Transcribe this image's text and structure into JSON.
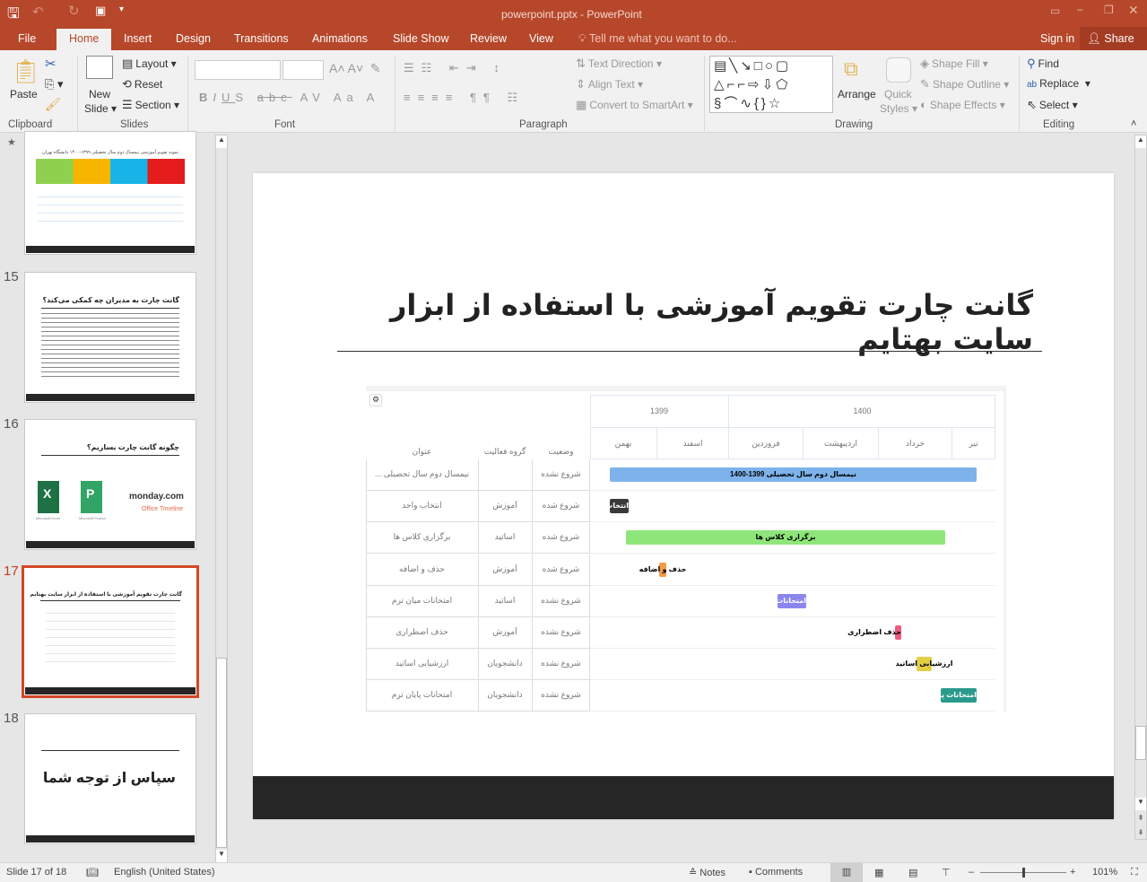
{
  "window": {
    "title": "powerpoint.pptx - PowerPoint"
  },
  "tabs": [
    "File",
    "Home",
    "Insert",
    "Design",
    "Transitions",
    "Animations",
    "Slide Show",
    "Review",
    "View"
  ],
  "tell_me": "Tell me what you want to do...",
  "sign_in": "Sign in",
  "share": "Share",
  "ribbon": {
    "clipboard": {
      "label": "Clipboard",
      "paste": "Paste"
    },
    "slides": {
      "label": "Slides",
      "new_slide": "New",
      "new_slide2": "Slide",
      "layout": "Layout",
      "reset": "Reset",
      "section": "Section"
    },
    "font": {
      "label": "Font"
    },
    "paragraph": {
      "label": "Paragraph",
      "text_direction": "Text Direction",
      "align_text": "Align Text",
      "convert_smartart": "Convert to SmartArt"
    },
    "drawing": {
      "label": "Drawing",
      "arrange": "Arrange",
      "quick": "Quick",
      "styles": "Styles",
      "shape_fill": "Shape Fill",
      "shape_outline": "Shape Outline",
      "shape_effects": "Shape Effects"
    },
    "editing": {
      "label": "Editing",
      "find": "Find",
      "replace": "Replace",
      "select": "Select"
    }
  },
  "thumbnails": [
    {
      "num": "",
      "title": "نمونه تقویم آموزشی نیمسال دوم سال تحصیلی ۱۳۹۹-۱۴۰۰ دانشگاه تهران"
    },
    {
      "num": "15",
      "title": "گانت چارت به مدیران چه کمکی می‌کند؟"
    },
    {
      "num": "16",
      "title": "چگونه گانت چارت بسازیم؟",
      "logos": [
        "monday.com",
        "Office Timeline",
        "Microsoft Excel",
        "Microsoft Project"
      ]
    },
    {
      "num": "17",
      "title": "گانت چارت تقویم آموزشی با استفاده از ابزار سایت بهتایم",
      "selected": true
    },
    {
      "num": "18",
      "title": "سپاس از توجه شما"
    }
  ],
  "slide": {
    "title": "گانت چارت تقویم آموزشی با استفاده از ابزار سایت بهتایم",
    "gantt": {
      "columns": {
        "status": "وضعیت",
        "group": "گروه فعالیت",
        "title": "عنوان"
      },
      "years": [
        "1399",
        "1400"
      ],
      "months": [
        "بهمن",
        "اسفند",
        "فروردین",
        "اردیبهشت",
        "خرداد",
        "تیر"
      ],
      "rows": [
        {
          "title": "نیمسال دوم سال تحصیلی ...",
          "group": "",
          "status": "شروع نشده",
          "bar": "نیمسال دوم سال تحصیلی 1399-1400",
          "color": "#7db3ea"
        },
        {
          "title": "انتخاب واحد",
          "group": "آموزش",
          "status": "شروع شده",
          "bar": "انتخاب واحد",
          "color": "#3a3a3a"
        },
        {
          "title": "برگزاری کلاس ها",
          "group": "اساتید",
          "status": "شروع شده",
          "bar": "برگزاری کلاس ها",
          "color": "#8ee67a"
        },
        {
          "title": "حذف و اضافه",
          "group": "آموزش",
          "status": "شروع شده",
          "bar": "حذف و اضافه",
          "color": "#f59a4a"
        },
        {
          "title": "امتحانات میان ترم",
          "group": "اساتید",
          "status": "شروع نشده",
          "bar": "امتحانات میان ترم",
          "color": "#8a86ee"
        },
        {
          "title": "حذف اضطراری",
          "group": "آموزش",
          "status": "شروع نشده",
          "bar": "حذف اضطراری",
          "color": "#ef5b7e"
        },
        {
          "title": "ارزشیابی اساتید",
          "group": "دانشجویان",
          "status": "شروع نشده",
          "bar": "ارزشیابی اساتید",
          "color": "#e3cf46"
        },
        {
          "title": "امتحانات پایان ترم",
          "group": "دانشجویان",
          "status": "شروع نشده",
          "bar": "امتحانات پایان ترم",
          "color": "#2a9a8c"
        }
      ]
    }
  },
  "status": {
    "slide": "Slide 17 of 18",
    "language": "English (United States)",
    "notes": "Notes",
    "comments": "Comments",
    "zoom": "101%",
    "zoom_level": 101
  }
}
